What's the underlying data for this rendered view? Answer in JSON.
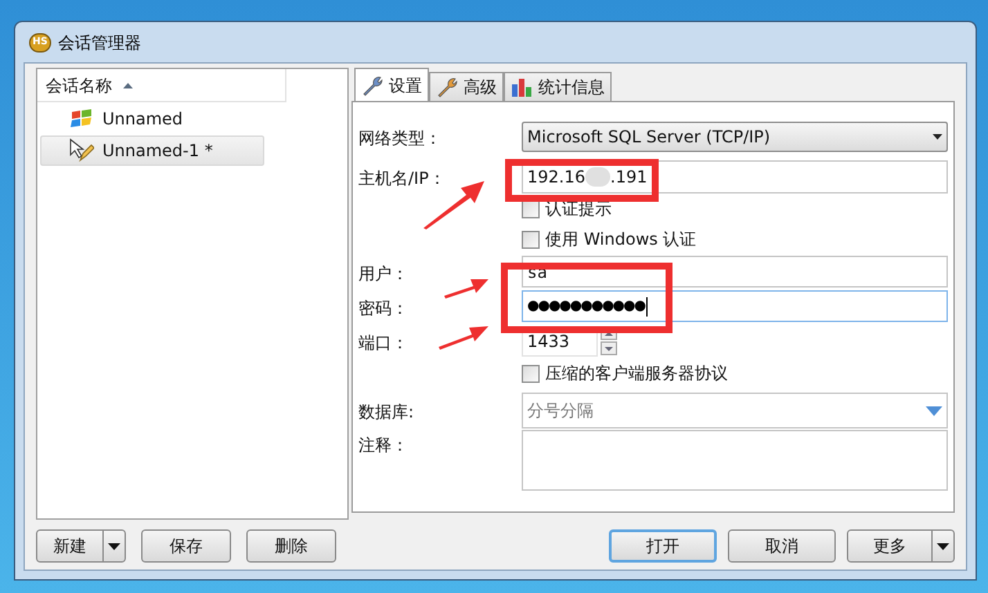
{
  "window": {
    "title": "会话管理器",
    "logo": "HS"
  },
  "session_list": {
    "column": "会话名称",
    "items": [
      {
        "name": "Unnamed",
        "selected": false,
        "kind": "windows"
      },
      {
        "name": "Unnamed-1 *",
        "selected": true,
        "kind": "edited"
      }
    ]
  },
  "tabs": [
    {
      "label": "设置",
      "selected": true,
      "kind": "settings"
    },
    {
      "label": "高级",
      "selected": false,
      "kind": "advanced"
    },
    {
      "label": "统计信息",
      "selected": false,
      "kind": "stats"
    }
  ],
  "form": [
    {
      "kind": "select",
      "label": "网络类型：",
      "value": "Microsoft SQL Server (TCP/IP)"
    },
    {
      "kind": "host",
      "label": "主机名/IP：",
      "value_start": "192.16",
      "value_end": ".191"
    },
    {
      "kind": "checkbox",
      "label": "认证提示",
      "checked": false
    },
    {
      "kind": "checkbox",
      "label": "使用 Windows 认证",
      "checked": false
    },
    {
      "kind": "text",
      "label": "用户：",
      "value": "sa"
    },
    {
      "kind": "password",
      "label": "密码：",
      "value": "●●●●●●●●●●●"
    },
    {
      "kind": "spin",
      "label": "端口：",
      "value": "1433"
    },
    {
      "kind": "checkbox",
      "label": "压缩的客户端服务器协议",
      "checked": false
    },
    {
      "kind": "combo",
      "label": "数据库:",
      "placeholder": "分号分隔"
    },
    {
      "kind": "memo",
      "label": "注释："
    }
  ],
  "buttons_left": [
    {
      "label": "新建",
      "kind": "split",
      "default": false
    },
    {
      "label": "保存",
      "kind": "plain",
      "default": false
    },
    {
      "label": "删除",
      "kind": "plain",
      "default": false
    }
  ],
  "buttons_right": [
    {
      "label": "打开",
      "kind": "plain",
      "default": true
    },
    {
      "label": "取消",
      "kind": "plain",
      "default": false
    },
    {
      "label": "更多",
      "kind": "split",
      "default": false
    }
  ]
}
